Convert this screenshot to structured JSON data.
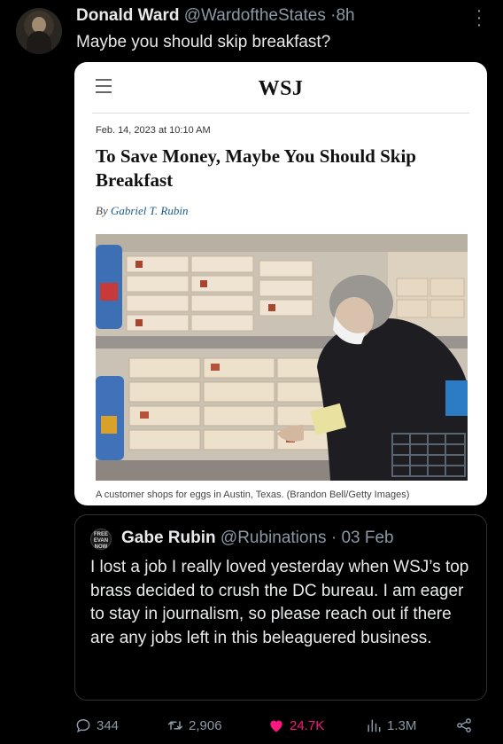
{
  "tweet": {
    "author_name": "Donald Ward",
    "author_handle": "@WardoftheStates",
    "separator": "·",
    "time": "8h",
    "text": "Maybe you should skip breakfast?"
  },
  "article_card": {
    "logo": "WSJ",
    "date": "Feb. 14, 2023 at 10:10 AM",
    "headline": "To Save Money, Maybe You Should Skip Breakfast",
    "byline_prefix": "By ",
    "byline_author": "Gabriel T. Rubin",
    "caption": "A customer shops for eggs in Austin, Texas. (Brandon Bell/Getty Images)"
  },
  "quoted_tweet": {
    "avatar_text": "FREE EVAN NOW",
    "author_name": "Gabe Rubin",
    "author_handle": "@Rubinations",
    "separator": "·",
    "time": "03 Feb",
    "text": "I lost a job I really loved yesterday when WSJ’s top brass decided to crush the DC bureau. I am eager to stay in journalism, so please reach out if there are any jobs left in this beleaguered business."
  },
  "actions": {
    "replies": "344",
    "retweets": "2,906",
    "likes": "24.7K",
    "views": "1.3M"
  },
  "colors": {
    "background": "#000000",
    "text": "#e7e9ea",
    "muted": "#8b98a5",
    "like": "#f91880",
    "card_bg": "#ffffff"
  }
}
